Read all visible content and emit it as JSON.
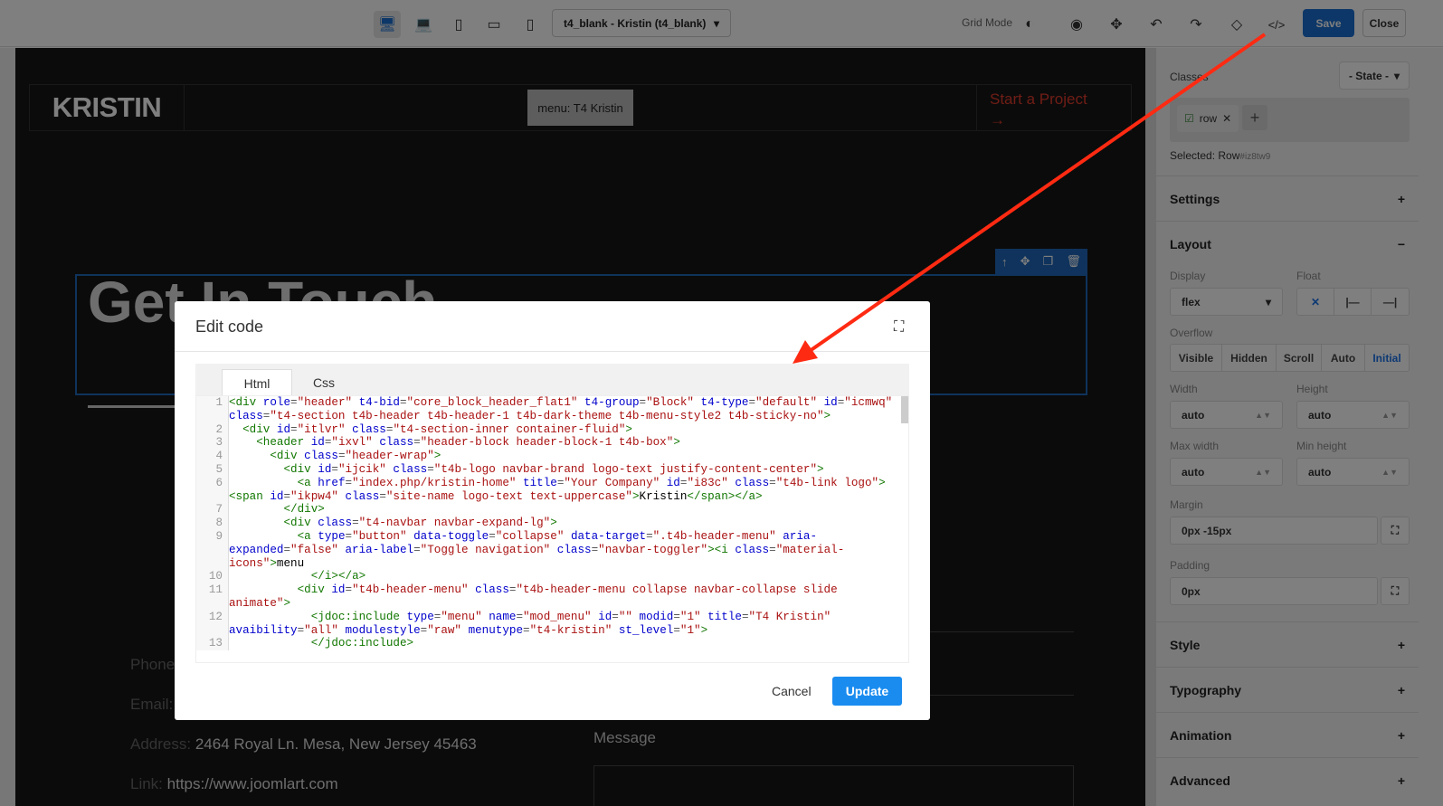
{
  "toolbar": {
    "devices": [
      "desktop-icon",
      "laptop-icon",
      "tablet-icon",
      "tablet-landscape-icon",
      "mobile-icon"
    ],
    "template_select": "t4_blank - Kristin (t4_blank)",
    "grid_mode_label": "Grid Mode",
    "save_label": "Save",
    "close_label": "Close"
  },
  "canvas": {
    "logo": "KRISTIN",
    "menu_placeholder": "menu: T4 Kristin",
    "cta": "Start a Project",
    "cta_arrow": "→",
    "heading": "Get In Touch",
    "contact": [
      {
        "label": "Phone:",
        "value": ""
      },
      {
        "label": "Email:",
        "value": ""
      },
      {
        "label": "Address:",
        "value": "2464 Royal Ln. Mesa, New Jersey 45463"
      },
      {
        "label": "Link:",
        "value": "https://www.joomlart.com"
      }
    ],
    "message_label": "Message"
  },
  "panel": {
    "classes_label": "Classes",
    "state_select": "- State -",
    "class_tag": "row",
    "selected_label": "Selected:",
    "selected_name": "Row",
    "selected_id": "#iz8tw9",
    "sections": {
      "settings": "Settings",
      "layout": "Layout",
      "style": "Style",
      "typography": "Typography",
      "animation": "Animation",
      "advanced": "Advanced"
    },
    "display_label": "Display",
    "display_value": "flex",
    "float_label": "Float",
    "overflow_label": "Overflow",
    "overflow_options": [
      "Visible",
      "Hidden",
      "Scroll",
      "Auto",
      "Initial"
    ],
    "overflow_selected": "Initial",
    "width_label": "Width",
    "width_value": "auto",
    "height_label": "Height",
    "height_value": "auto",
    "maxwidth_label": "Max width",
    "maxwidth_value": "auto",
    "minheight_label": "Min height",
    "minheight_value": "auto",
    "margin_label": "Margin",
    "margin_value": "0px -15px",
    "padding_label": "Padding",
    "padding_value": "0px"
  },
  "modal": {
    "title": "Edit code",
    "tabs": [
      "Html",
      "Css"
    ],
    "active_tab": "Html",
    "code_lines": [
      "<div role=\"header\" t4-bid=\"core_block_header_flat1\" t4-group=\"Block\" t4-type=\"default\" id=\"icmwq\" class=\"t4-section t4b-header t4b-header-1 t4b-dark-theme t4b-menu-style2 t4b-sticky-no\">",
      "  <div id=\"itlvr\" class=\"t4-section-inner container-fluid\">",
      "    <header id=\"ixvl\" class=\"header-block header-block-1 t4b-box\">",
      "      <div class=\"header-wrap\">",
      "        <div id=\"ijcik\" class=\"t4b-logo navbar-brand logo-text justify-content-center\">",
      "          <a href=\"index.php/kristin-home\" title=\"Your Company\" id=\"i83c\" class=\"t4b-link logo\"><span id=\"ikpw4\" class=\"site-name logo-text text-uppercase\">Kristin</span></a>",
      "        </div>",
      "        <div class=\"t4-navbar navbar-expand-lg\">",
      "          <a type=\"button\" data-toggle=\"collapse\" data-target=\".t4b-header-menu\" aria-expanded=\"false\" aria-label=\"Toggle navigation\" class=\"navbar-toggler\"><i class=\"material-icons\">menu",
      "            </i></a>",
      "          <div id=\"t4b-header-menu\" class=\"t4b-header-menu collapse navbar-collapse slide animate\">",
      "            <jdoc:include type=\"menu\" name=\"mod_menu\" id=\"\" modid=\"1\" title=\"T4 Kristin\" avaibility=\"all\" modulestyle=\"raw\" menutype=\"t4-kristin\" st_level=\"1\">",
      "            </jdoc:include>"
    ],
    "cancel_label": "Cancel",
    "update_label": "Update"
  },
  "colors": {
    "accent": "#1a73e8",
    "cta": "#e03a2c",
    "arrow": "#ff2a12"
  }
}
